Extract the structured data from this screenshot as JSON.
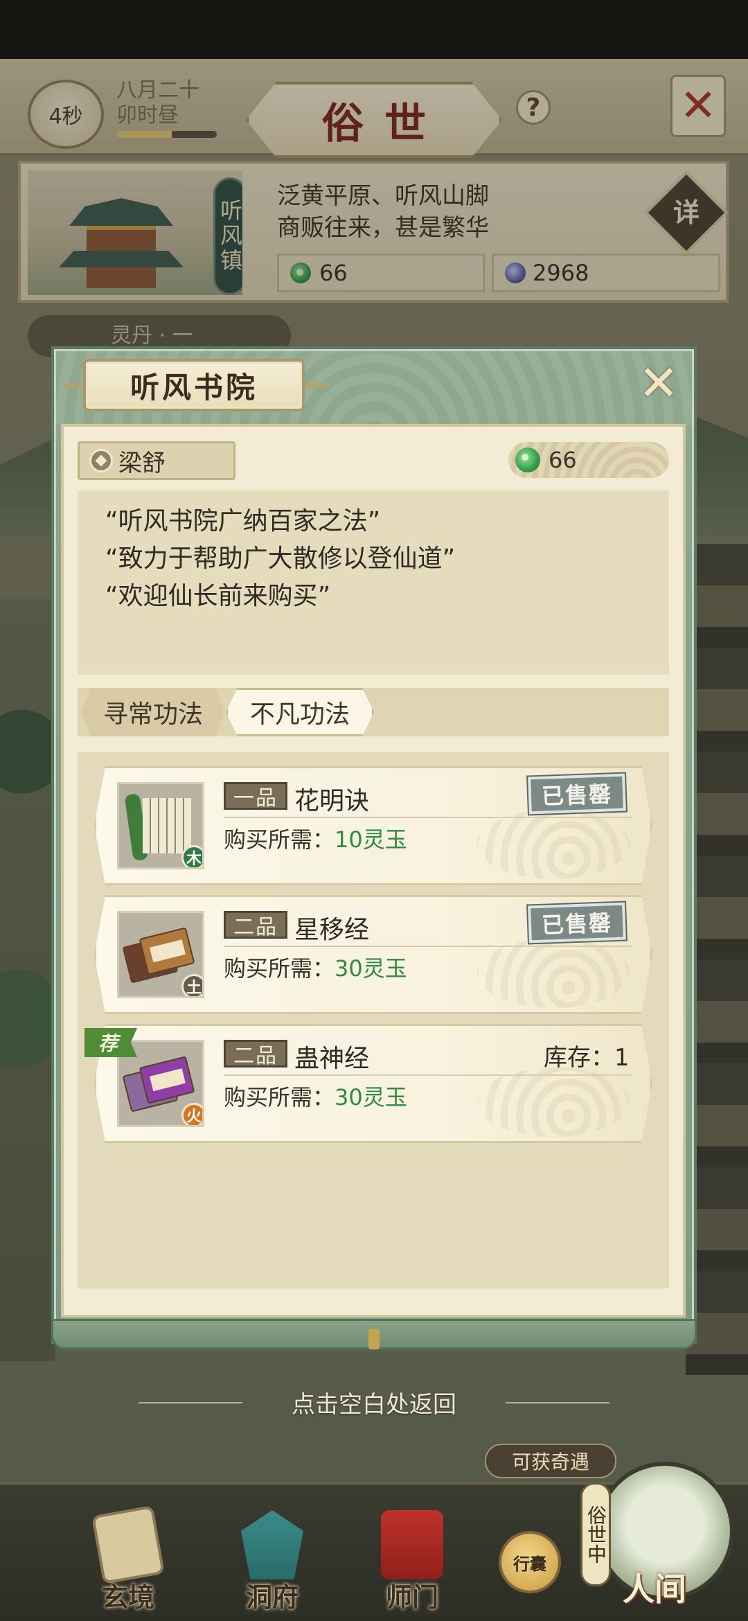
{
  "header": {
    "timer": "4秒",
    "date_line1": "八月二十",
    "date_line2": "卯时昼",
    "day_progress": 0.55,
    "title": "俗世",
    "help": "?",
    "close": "✕"
  },
  "town": {
    "name": "听风镇",
    "desc_line1": "泛黄平原、听风山脚",
    "desc_line2": "商贩往来，甚是繁华",
    "detail_label": "详",
    "jade": "66",
    "spirit_stone": "2968"
  },
  "background": {
    "tag": "灵丹 · 一"
  },
  "dialog": {
    "title": "听风书院",
    "close": "✕",
    "npc_name": "梁舒",
    "jade": "66",
    "quotes": [
      "“听风书院广纳百家之法”",
      "“致力于帮助广大散修以登仙道”",
      "“欢迎仙长前来购买”"
    ],
    "tabs": [
      {
        "label": "寻常功法",
        "active": false
      },
      {
        "label": "不凡功法",
        "active": true
      }
    ],
    "price_label": "购买所需：",
    "items": [
      {
        "grade": "一品",
        "name": "花明诀",
        "cost": "10灵玉",
        "status": "已售罄",
        "element": "木",
        "recommended": false
      },
      {
        "grade": "二品",
        "name": "星移经",
        "cost": "30灵玉",
        "status": "已售罄",
        "element": "土",
        "recommended": false
      },
      {
        "grade": "二品",
        "name": "蛊神经",
        "cost": "30灵玉",
        "stock": "库存：1",
        "element": "火",
        "recommended": true,
        "rec_label": "荐"
      }
    ],
    "return_hint": "点击空白处返回"
  },
  "bottom_nav": {
    "encounter": "可获奇遇",
    "items": [
      {
        "label": "玄境"
      },
      {
        "label": "洞府"
      },
      {
        "label": "师门"
      }
    ],
    "bag": "行囊",
    "world_side": "俗世中",
    "world": "人间"
  },
  "colors": {
    "title_red": "#7d2a22",
    "jade_green": "#2f8a3e",
    "panel_cream": "#f3ecd5",
    "dialog_green": "#8fa88f"
  }
}
